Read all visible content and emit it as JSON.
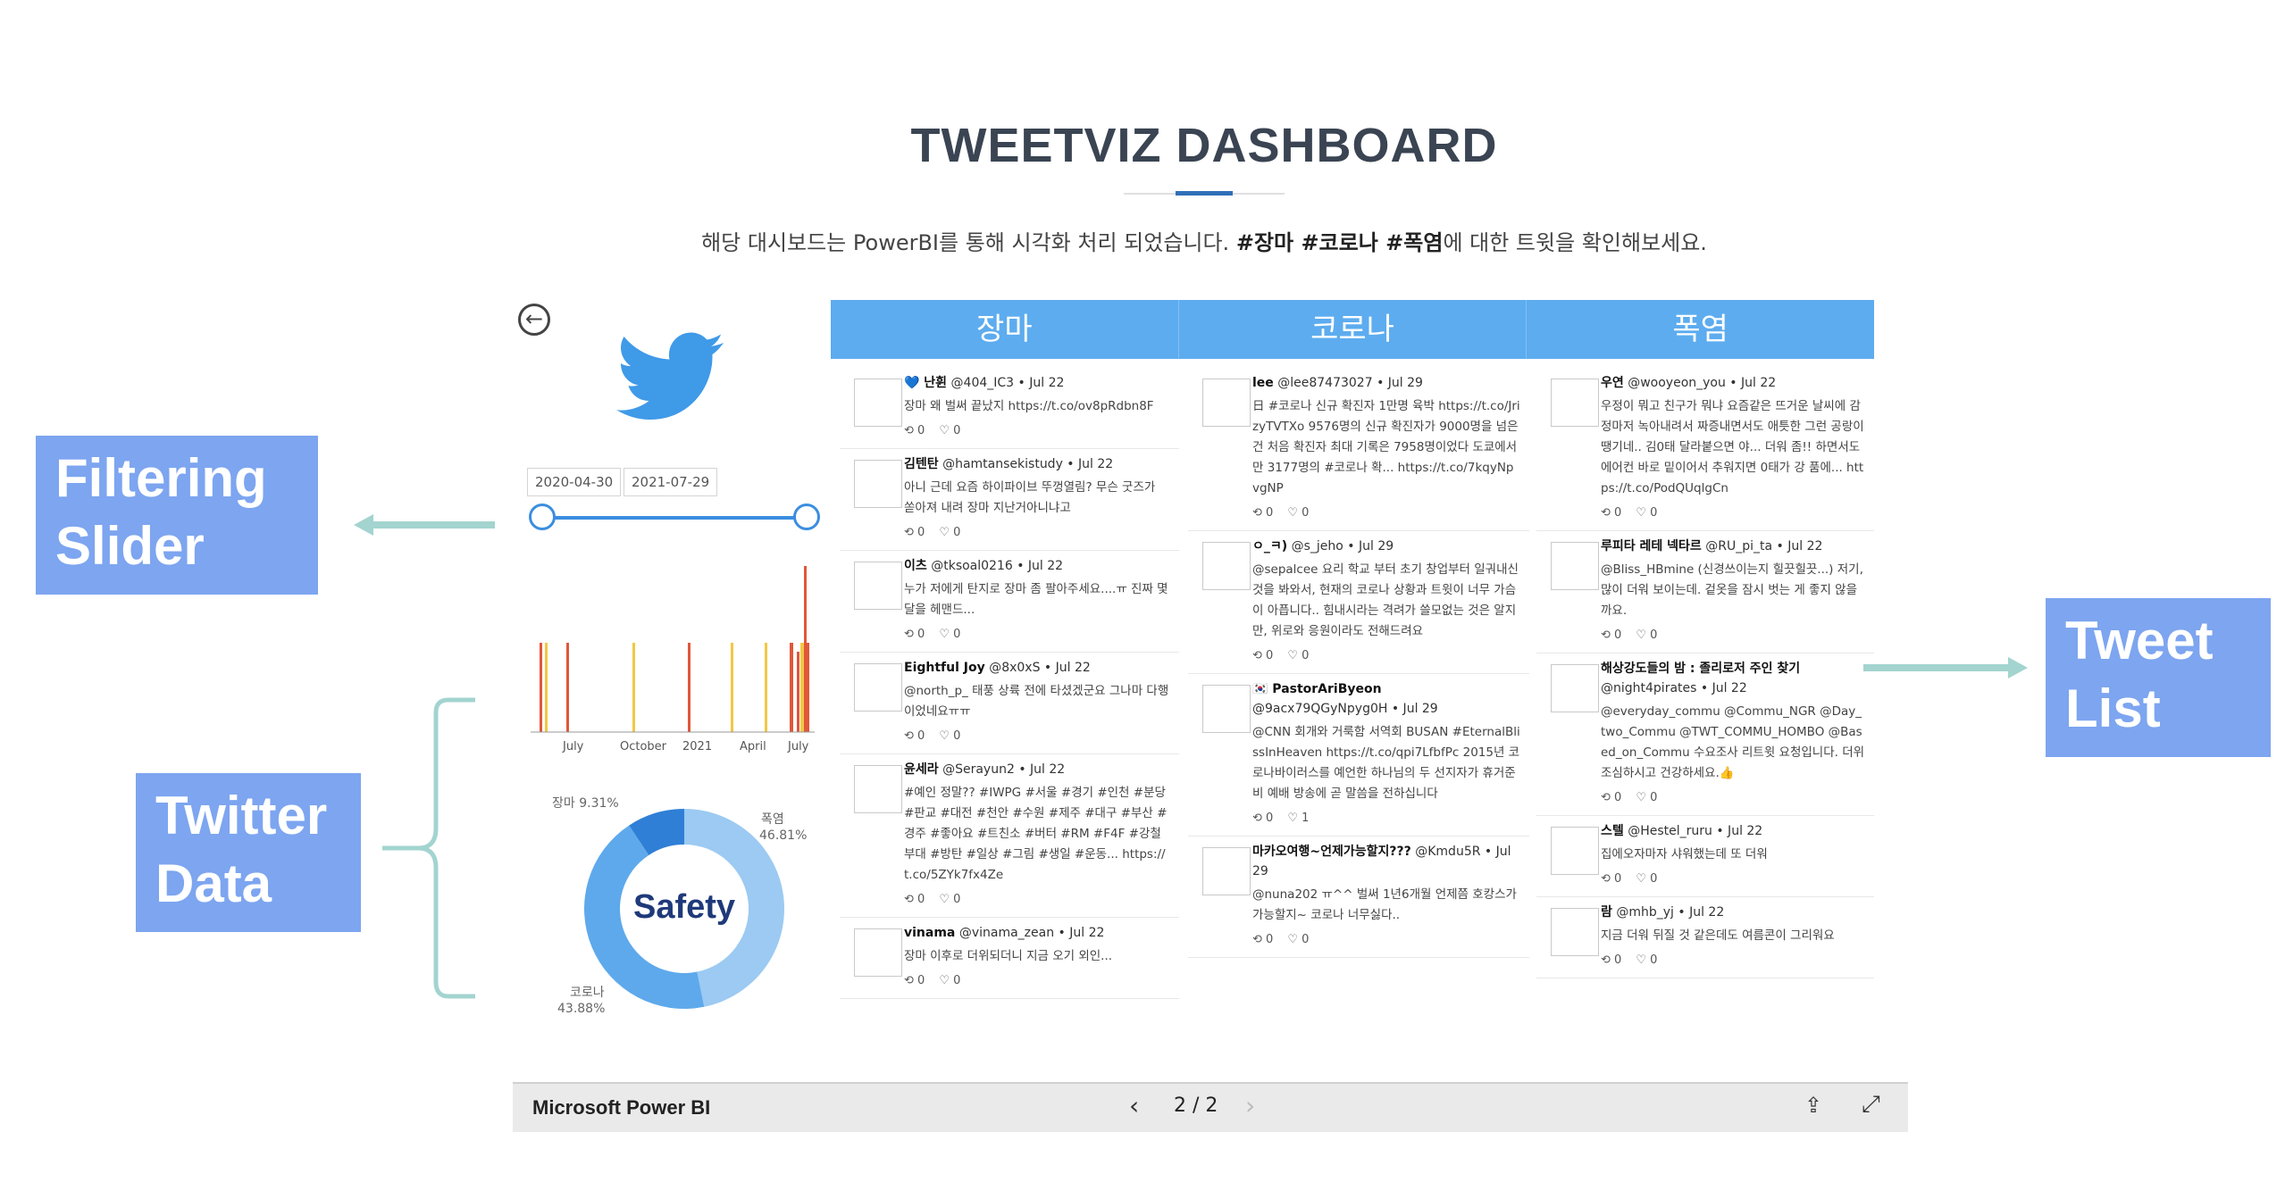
{
  "header": {
    "title": "TWEETVIZ DASHBOARD",
    "subtitle_prefix": "해당 대시보드는 PowerBI를 통해 시각화 처리 되었습니다. ",
    "subtitle_bold": "#장마 #코로나 #폭염",
    "subtitle_suffix": "에 대한 트윗을 확인해보세요."
  },
  "annotations": {
    "filtering_line1": "Filtering",
    "filtering_line2": "Slider",
    "twitter_line1": "Twitter",
    "twitter_line2": "Data",
    "tweet_line1": "Tweet",
    "tweet_line2": "List"
  },
  "filter": {
    "start_date": "2020-04-30",
    "end_date": "2021-07-29"
  },
  "bar_chart": {
    "x_labels": [
      "July",
      "October",
      "2021",
      "April",
      "July"
    ]
  },
  "chart_data": {
    "type": "pie",
    "categories": [
      "장마",
      "폭염",
      "코로나"
    ],
    "values": [
      9.31,
      46.81,
      43.88
    ],
    "center_label": "Safety",
    "labels": [
      "장마 9.31%",
      "폭염 46.81%",
      "코로나 43.88%"
    ]
  },
  "colors": {
    "accent": "#5dacef",
    "donut": [
      "#2f7fd6",
      "#9ccaf2",
      "#5ea9ec"
    ],
    "bar_yellow": "#f2c744",
    "bar_red": "#e0573a"
  },
  "columns": [
    {
      "title": "장마",
      "tweets": [
        {
          "name": "💙 난휜",
          "handle": "@404_IC3 • Jul 22",
          "text": "장마 왜 벌써 끝났지 https://t.co/ov8pRdbn8F",
          "rt": "0",
          "like": "0"
        },
        {
          "name": "김텐탄",
          "handle": "@hamtansekistudy • Jul 22",
          "text": "아니 근데 요즘 하이파이브 뚜껑열림? 무슨 굿즈가 쏟아져 내려 장마 지난거아니냐고",
          "rt": "0",
          "like": "0"
        },
        {
          "name": "이츠",
          "handle": "@tksoal0216 • Jul 22",
          "text": "누가 저에게 탄지로 장마 좀 팔아주세요....ㅠ 진짜 몇 달을 헤맨드...",
          "rt": "0",
          "like": "0"
        },
        {
          "name": "Eightful Joy",
          "handle": "@8x0xS • Jul 22",
          "text": "@north_p_ 태풍 상륙 전에 타셨겠군요 그나마 다행이었네요ㅠㅠ",
          "rt": "0",
          "like": "0"
        },
        {
          "name": "윤세라",
          "handle": "@Serayun2 • Jul 22",
          "text": "#예인 정말?? #IWPG #서울 #경기 #인천 #분당 #판교 #대전 #천안 #수원 #제주 #대구 #부산 #경주 #좋아요 #트친소 #버터 #RM #F4F #강철부대 #방탄 #일상 #그림 #생일 #운동... https://t.co/5ZYk7fx4Ze",
          "rt": "0",
          "like": "0"
        },
        {
          "name": "vinama",
          "handle": "@vinama_zean • Jul 22",
          "text": "장마 이후로 더위되더니 지금 오기 외인...",
          "rt": "0",
          "like": "0"
        }
      ]
    },
    {
      "title": "코로나",
      "tweets": [
        {
          "name": "lee",
          "handle": "@lee87473027 • Jul 29",
          "text": "日 #코로나 신규 확진자 1만명 육박 https://t.co/JrizyTVTXo 9576명의 신규 확진자가 9000명을 넘은건 처음 확진자 최대 기록은 7958명이었다 도쿄에서만 3177명의 #코로나 확... https://t.co/7kqyNpvgNP",
          "rt": "0",
          "like": "0"
        },
        {
          "name": "ㅇ_ㅋ)",
          "handle": "@s_jeho • Jul 29",
          "text": "@sepalcee 요리 학교 부터 초기 창업부터 일궈내신 것을 봐와서, 현재의 코로나 상황과 트윗이 너무 가슴이 아픕니다.. 힘내시라는 격려가 쓸모없는 것은 알지만, 위로와 응원이라도 전해드려요",
          "rt": "0",
          "like": "0"
        },
        {
          "name": "🇰🇷 PastorAriByeon",
          "handle": "@9acx79QGyNpyg0H • Jul 29",
          "text": "@CNN 회개와 거룩함 서역회 BUSAN #EternalBlissInHeaven https://t.co/qpi7LfbfPc 2015년 코로나바이러스를 예언한 하나님의 두 선지자가 휴거준비 예배 방송에 곧 말씀을 전하십니다",
          "rt": "0",
          "like": "1"
        },
        {
          "name": "마카오여행~언제가능할지???",
          "handle": "@Kmdu5R • Jul 29",
          "text": "@nuna202 ㅠ^^ 벌써 1년6개월 언제쯤 호캉스가 가능할지~ 코로나 너무싫다..",
          "rt": "0",
          "like": "0"
        }
      ]
    },
    {
      "title": "폭염",
      "tweets": [
        {
          "name": "우연",
          "handle": "@wooyeon_you • Jul 22",
          "text": "우정이 뭐고 친구가 뭐냐 요즘같은 뜨거운 날씨에 감정마저 녹아내려서 짜증내면서도 애틋한 그런 공랑이 땡기네.. 김0태 달라붙으면 야... 더워 좀!! 하면서도 에어컨 바로 밑이어서 추워지면 0태가 강 품에... https://t.co/PodQUqlgCn",
          "rt": "0",
          "like": "0"
        },
        {
          "name": "루피타 레테 넥타르",
          "handle": "@RU_pi_ta • Jul 22",
          "text": "@Bliss_HBmine (신경쓰이는지 힐끗힐끗...) 저기, 많이 더워 보이는데. 겉옷을 잠시 벗는 게 좋지 않을까요.",
          "rt": "0",
          "like": "0"
        },
        {
          "name": "해상강도들의 밤 : 졸리로저 주인 찾기",
          "handle": "@night4pirates • Jul 22",
          "text": "@everyday_commu @Commu_NGR @Day_two_Commu @TWT_COMMU_HOMBO @Based_on_Commu 수요조사 리트윗 요청입니다. 더위 조심하시고 건강하세요.👍",
          "rt": "0",
          "like": "0"
        },
        {
          "name": "스텔",
          "handle": "@Hestel_ruru • Jul 22",
          "text": "집에오자마자 샤워했는데 또 더워",
          "rt": "0",
          "like": "0"
        },
        {
          "name": "람",
          "handle": "@mhb_yj • Jul 22",
          "text": "지금 더워 뒤질 것 같은데도 여름콘이 그리워요",
          "rt": "0",
          "like": "0"
        }
      ]
    }
  ],
  "footer": {
    "brand": "Microsoft Power BI",
    "page": "2 / 2",
    "prev_icon": "chevron-left-icon",
    "next_icon": "chevron-right-icon"
  }
}
